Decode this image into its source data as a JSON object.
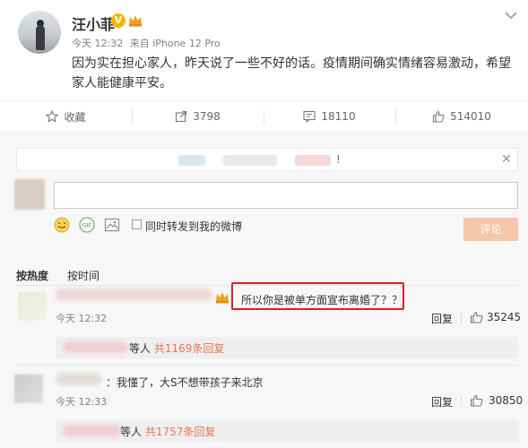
{
  "post": {
    "username": "汪小菲",
    "verified_badge": "V",
    "time": "今天 12:32",
    "source": "来自 iPhone 12 Pro",
    "content": "因为实在担心家人，昨天说了一些不好的话。疫情期间确实情绪容易激动，希望家人能健康平安。"
  },
  "actions": {
    "favorite_label": "收藏",
    "forward_count": "3798",
    "comment_count": "18110",
    "like_count": "514010"
  },
  "notice": {
    "suffix": "!"
  },
  "compose": {
    "sync_label": "同时转发到我的微博",
    "submit_label": "评论",
    "gif_label": "GIF"
  },
  "sort": {
    "hot_label": "按热度",
    "time_label": "按时间"
  },
  "comments": [
    {
      "text": "所以你是被单方面宣布离婚了？？",
      "time": "今天 12:32",
      "reply_label": "回复",
      "likes": "35245",
      "sub_prefix": "等人",
      "sub_link": "共1169条回复"
    },
    {
      "text": "：我懂了，大S不想带孩子来北京",
      "time": "今天 12:33",
      "reply_label": "回复",
      "likes": "30850",
      "sub_prefix": "等人",
      "sub_link": "共1757条回复"
    }
  ],
  "colors": {
    "accent": "#eb7350",
    "highlight_box": "#d2232a",
    "verified": "#f7b500",
    "submit_disabled": "#f8c6a8"
  },
  "icons": [
    "more-chevron-icon",
    "star-icon",
    "forward-icon",
    "comment-icon",
    "like-icon",
    "emoji-icon",
    "gif-icon",
    "image-icon",
    "crown-icon",
    "close-icon"
  ]
}
